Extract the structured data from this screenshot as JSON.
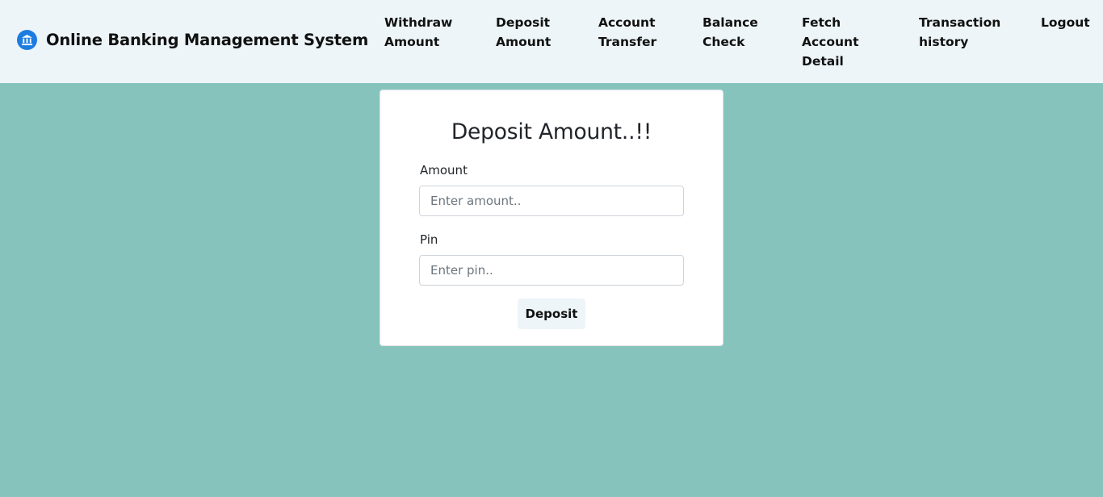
{
  "navbar": {
    "brand_icon": "bank-icon",
    "brand_title": "Online Banking Management System",
    "links": [
      {
        "line1": "Withdraw",
        "line2": "Amount"
      },
      {
        "line1": "Deposit",
        "line2": "Amount"
      },
      {
        "line1": "Account",
        "line2": "Transfer"
      },
      {
        "line1": "Balance",
        "line2": "Check"
      },
      {
        "line1": "Fetch",
        "line2": "Account",
        "line3": "Detail"
      },
      {
        "line1": "Transaction",
        "line2": "history"
      },
      {
        "line1": "Logout"
      }
    ]
  },
  "form": {
    "title": "Deposit Amount..!!",
    "amount_label": "Amount",
    "amount_value": "",
    "amount_placeholder": "Enter amount..",
    "pin_label": "Pin",
    "pin_value": "",
    "pin_placeholder": "Enter pin..",
    "submit_label": "Deposit"
  },
  "colors": {
    "page_background": "#86c3bd",
    "navbar_background": "#edf5f8",
    "brand_icon": "#1c7ce0",
    "card_background": "#ffffff"
  }
}
